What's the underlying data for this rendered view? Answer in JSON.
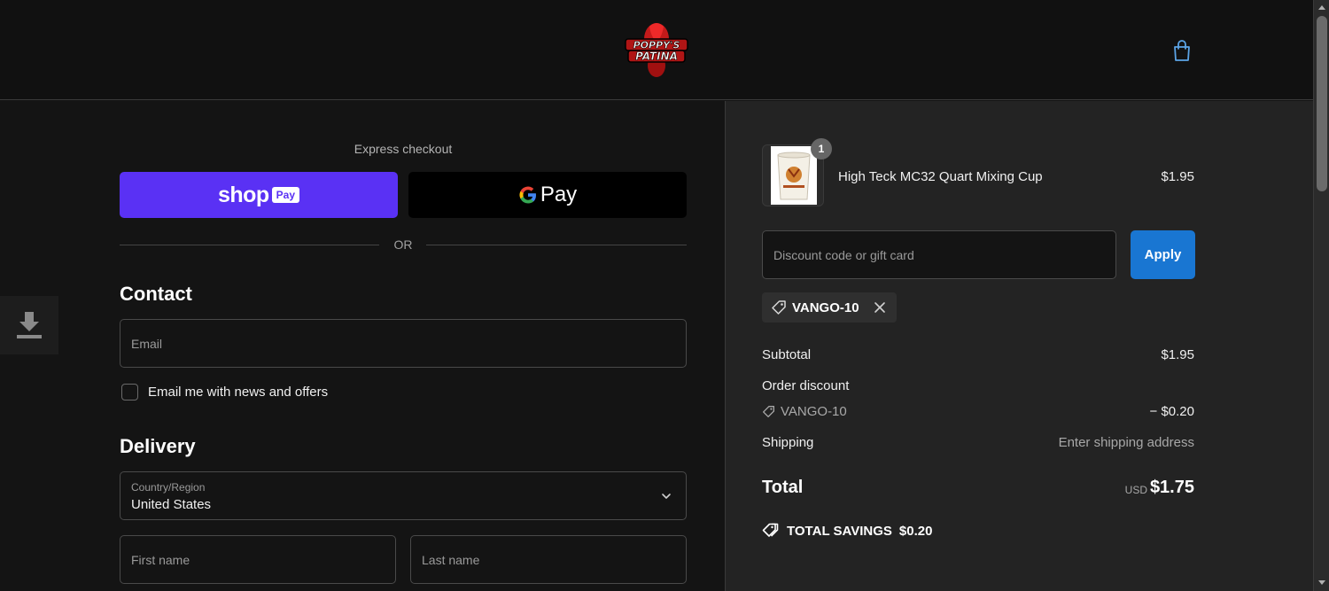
{
  "brand": {
    "logo_line1": "POPPY'S",
    "logo_line2": "PATINA"
  },
  "express": {
    "label": "Express checkout",
    "shop_label": "shop",
    "shop_pay_label": "Pay",
    "gpay_label": "Pay",
    "or_label": "OR"
  },
  "contact": {
    "title": "Contact",
    "email_placeholder": "Email",
    "newsletter_label": "Email me with news and offers"
  },
  "delivery": {
    "title": "Delivery",
    "country_label": "Country/Region",
    "country_value": "United States",
    "first_name_placeholder": "First name",
    "last_name_placeholder": "Last name"
  },
  "order": {
    "item": {
      "name": "High Teck MC32 Quart Mixing Cup",
      "price": "$1.95",
      "quantity": "1"
    },
    "discount_placeholder": "Discount code or gift card",
    "apply_label": "Apply",
    "applied_code": "VANGO-10",
    "subtotal_label": "Subtotal",
    "subtotal_value": "$1.95",
    "order_discount_label": "Order discount",
    "discount_code": "VANGO-10",
    "discount_value": "− $0.20",
    "shipping_label": "Shipping",
    "shipping_value": "Enter shipping address",
    "total_label": "Total",
    "currency": "USD",
    "total_value": "$1.75",
    "savings_label": "TOTAL SAVINGS",
    "savings_value": "$0.20"
  },
  "icons": {
    "cart": "shopping-bag-icon",
    "tag": "tag-icon",
    "close": "close-icon",
    "chevron": "chevron-down-icon",
    "download": "download-icon"
  },
  "colors": {
    "shop_pay": "#5a31f4",
    "apply": "#1976d2",
    "cart_icon": "#5ba4e6",
    "background": "#141414",
    "summary_bg": "#232323"
  }
}
